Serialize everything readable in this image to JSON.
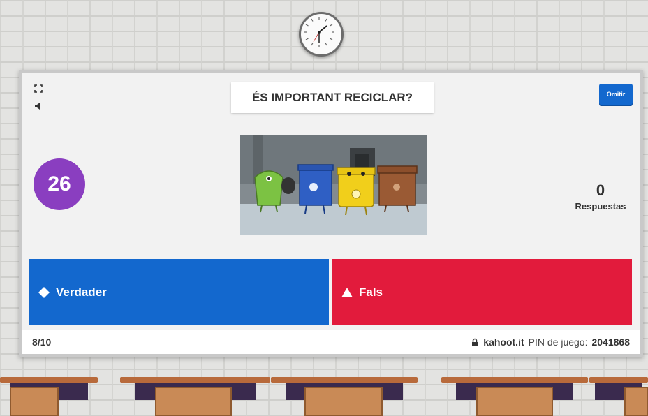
{
  "question": {
    "text": "ÉS IMPORTANT RECICLAR?"
  },
  "controls": {
    "skip_label": "Omitir",
    "expand_icon": "expand-icon",
    "sound_icon": "speaker-icon"
  },
  "timer": {
    "value": "26"
  },
  "answers_count": {
    "value": "0",
    "label": "Respuestas"
  },
  "answers": [
    {
      "label": "Verdader",
      "shape": "diamond",
      "color": "#1368ce"
    },
    {
      "label": "Fals",
      "shape": "triangle",
      "color": "#e21b3c"
    }
  ],
  "footer": {
    "progress": "8/10",
    "site": "kahoot.it",
    "pin_label": "PIN de juego:",
    "pin": "2041868",
    "lock_icon": "lock-icon"
  },
  "colors": {
    "timer": "#8a3ec0",
    "skip_button": "#1368ce"
  }
}
